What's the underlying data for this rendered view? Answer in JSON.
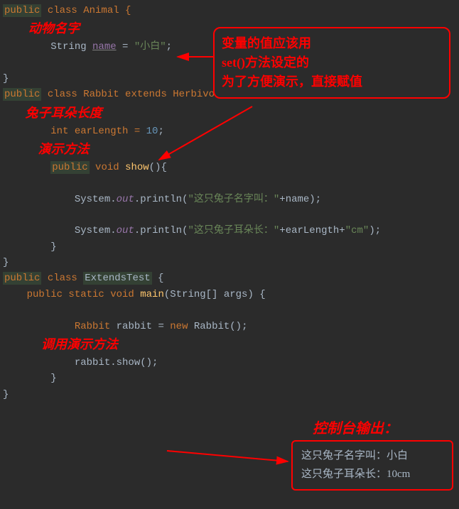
{
  "code": {
    "l1_public": "public",
    "l1_rest": " class Animal {",
    "ann_animal_name": "        动物名字",
    "l3_a": "        String ",
    "l3_name": "name",
    "l3_b": " = ",
    "l3_str": "\"小白\"",
    "l3_c": ";",
    "l5": "}",
    "l6_public": "public",
    "l6_rest": " class Rabbit extends Herbivore {",
    "ann_ear": "       兔子耳朵长度",
    "l8_a": "        int earLength = ",
    "l8_num": "10",
    "l8_b": ";",
    "ann_show": "           演示方法",
    "l9_public": "public",
    "l9_void": " void ",
    "l9_show": "show",
    "l9_c": "(){",
    "l11_a": "            System.",
    "l11_out": "out",
    "l11_b": ".println(",
    "l11_str": "\"这只兔子名字叫：\"",
    "l11_c": "+name);",
    "l13_a": "            System.",
    "l13_out": "out",
    "l13_b": ".println(",
    "l13_str": "\"这只兔子耳朵长：\"",
    "l13_c": "+earLength+",
    "l13_cm": "\"cm\"",
    "l13_d": ");",
    "l14": "        }",
    "l15": "}",
    "l16_public": "public",
    "l16_a": " class ",
    "l16_cls": "ExtendsTest",
    "l16_b": " {",
    "l17_a": "    public static void ",
    "l17_main": "main",
    "l17_b": "(String[] args) {",
    "l19_a": "            Rabbit rabbit = new Rabbit();",
    "ann_call": "            调用演示方法",
    "l21_a": "            rabbit.show();",
    "l22": "        }",
    "l23": "}"
  },
  "box1": {
    "line1": "变量的值应该用",
    "line2": "set()方法设定的",
    "line3": "为了方便演示，直接赋值"
  },
  "output": {
    "title": "控制台输出：",
    "line1": "这只兔子名字叫：小白",
    "line2": "这只兔子耳朵长：10cm"
  }
}
